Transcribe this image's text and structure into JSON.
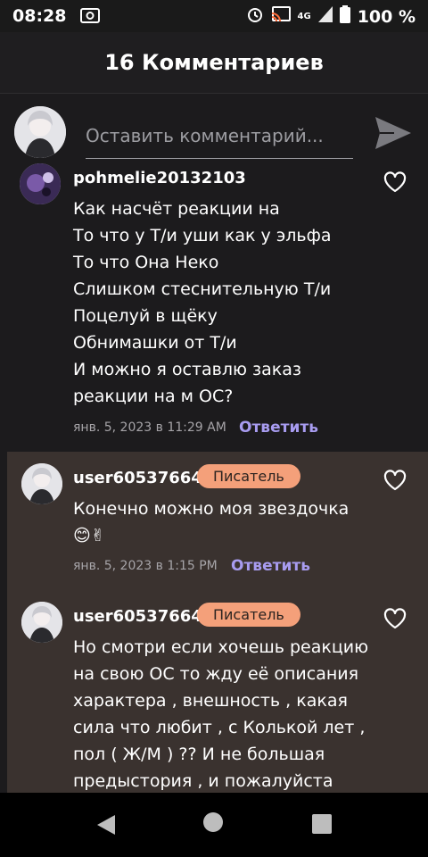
{
  "status_bar": {
    "time": "08:28",
    "network": "4G",
    "battery": "100 %"
  },
  "header": {
    "title": "16 Комментариев"
  },
  "composer": {
    "placeholder": "Оставить комментарий...",
    "send_icon": "send-icon"
  },
  "comments": [
    {
      "username": "pohmelie20132103",
      "badge": "",
      "lines": [
        "Как насчёт реакции на",
        "То что у Т/и уши как у эльфа",
        "То что Она Неко",
        "Слишком стеснительную Т/и",
        "Поцелуй в щёку",
        "Обнимашки от Т/и",
        "И можно я оставлю заказ",
        "реакции на м ОС?"
      ],
      "timestamp": "янв. 5, 2023 в 11:29 AM",
      "reply_label": "Ответить"
    },
    {
      "username": "user60537664",
      "badge": "Писатель",
      "lines": [
        "Конечно можно моя звездочка",
        "😊✌"
      ],
      "timestamp": "янв. 5, 2023 в 1:15 PM",
      "reply_label": "Ответить"
    },
    {
      "username": "user60537664",
      "badge": "Писатель",
      "lines": [
        "Но смотри если хочешь реакцию",
        "на свою ОС то жду её описания",
        "характера , внешность , какая",
        "сила что любит , с Колькой лет ,",
        "пол ( Ж/М ) ?? И не большая",
        "предыстория , и пожалуйста"
      ]
    }
  ],
  "colors": {
    "background": "#1c1b1d",
    "reply_background": "#3a322f",
    "badge": "#f4a07a",
    "reply_link": "#a89cf0"
  },
  "icons": [
    "alarm-icon",
    "cast-icon",
    "signal-icon",
    "battery-icon",
    "heart-icon",
    "back-icon",
    "home-icon",
    "recents-icon"
  ]
}
